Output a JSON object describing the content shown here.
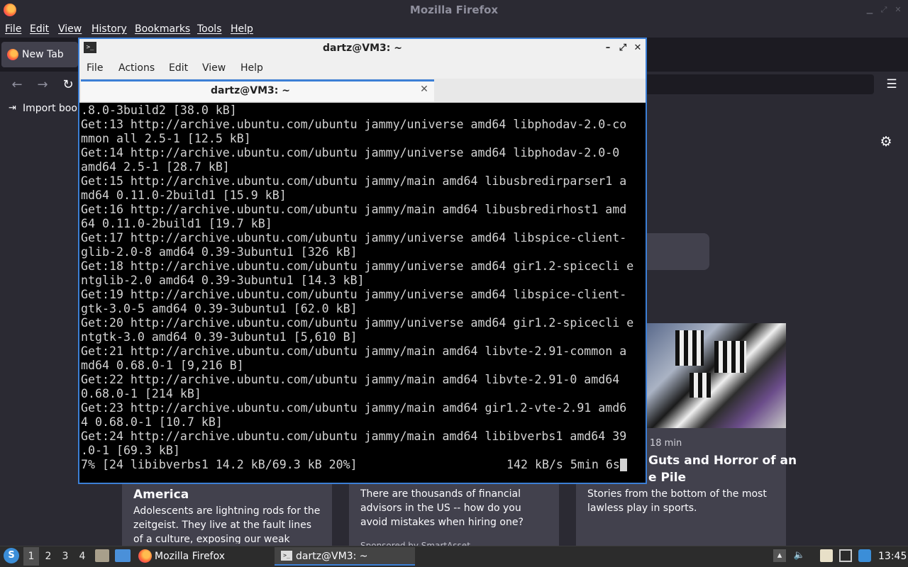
{
  "firefox": {
    "window_title": "Mozilla Firefox",
    "menu": [
      "File",
      "Edit",
      "View",
      "History",
      "Bookmarks",
      "Tools",
      "Help"
    ],
    "tab_label": "New Tab",
    "bookmarks_toolbar": {
      "import_label": "Import bookmarks..."
    },
    "cards": [
      {
        "title": "America",
        "body": "Adolescents are lightning rods for the zeitgeist. They live at the fault lines of a culture, exposing our weak spots,..."
      },
      {
        "body": "There are thousands of financial advisors in the US -- how do you avoid mistakes when hiring one?",
        "sponsor": "Sponsored by SmartAsset"
      },
      {
        "meta": "18 min",
        "title_line1": "Guts and Horror of an",
        "title_line2": "e Pile",
        "body": "Stories from the bottom of the most lawless play in sports."
      }
    ],
    "icons": [
      "firefox-logo-icon",
      "back-icon",
      "forward-icon",
      "reload-icon",
      "hamburger-menu-icon",
      "import-icon",
      "gear-icon"
    ]
  },
  "terminal": {
    "window_title": "dartz@VM3: ~",
    "menu": [
      "File",
      "Actions",
      "Edit",
      "View",
      "Help"
    ],
    "tab_label": "dartz@VM3: ~",
    "output_lines": [
      ".8.0-3build2 [38.0 kB]",
      "Get:13 http://archive.ubuntu.com/ubuntu jammy/universe amd64 libphodav-2.0-co",
      "mmon all 2.5-1 [12.5 kB]",
      "Get:14 http://archive.ubuntu.com/ubuntu jammy/universe amd64 libphodav-2.0-0",
      "amd64 2.5-1 [28.7 kB]",
      "Get:15 http://archive.ubuntu.com/ubuntu jammy/main amd64 libusbredirparser1 a",
      "md64 0.11.0-2build1 [15.9 kB]",
      "Get:16 http://archive.ubuntu.com/ubuntu jammy/main amd64 libusbredirhost1 amd",
      "64 0.11.0-2build1 [19.7 kB]",
      "Get:17 http://archive.ubuntu.com/ubuntu jammy/universe amd64 libspice-client-",
      "glib-2.0-8 amd64 0.39-3ubuntu1 [326 kB]",
      "Get:18 http://archive.ubuntu.com/ubuntu jammy/universe amd64 gir1.2-spicecli e",
      "ntglib-2.0 amd64 0.39-3ubuntu1 [14.3 kB]",
      "Get:19 http://archive.ubuntu.com/ubuntu jammy/universe amd64 libspice-client-",
      "gtk-3.0-5 amd64 0.39-3ubuntu1 [62.0 kB]",
      "Get:20 http://archive.ubuntu.com/ubuntu jammy/universe amd64 gir1.2-spicecli e",
      "ntgtk-3.0 amd64 0.39-3ubuntu1 [5,610 B]",
      "Get:21 http://archive.ubuntu.com/ubuntu jammy/main amd64 libvte-2.91-common a",
      "md64 0.68.0-1 [9,216 B]",
      "Get:22 http://archive.ubuntu.com/ubuntu jammy/main amd64 libvte-2.91-0 amd64",
      "0.68.0-1 [214 kB]",
      "Get:23 http://archive.ubuntu.com/ubuntu jammy/main amd64 gir1.2-vte-2.91 amd6",
      "4 0.68.0-1 [10.7 kB]",
      "Get:24 http://archive.ubuntu.com/ubuntu jammy/main amd64 libibverbs1 amd64 39",
      ".0-1 [69.3 kB]"
    ],
    "status_left": "7% [24 libibverbs1 14.2 kB/69.3 kB 20%]",
    "status_right": "142 kB/s 5min 6s"
  },
  "taskbar": {
    "start_icon_glyph": "S",
    "workspaces": [
      "1",
      "2",
      "3",
      "4"
    ],
    "apps": [
      {
        "label": "Mozilla Firefox",
        "icon": "firefox-icon"
      },
      {
        "label": "dartz@VM3: ~",
        "icon": "terminal-icon"
      }
    ],
    "clock": "13:45",
    "tray_icons": [
      "show-desktop-icon",
      "volume-icon",
      "clipboard-icon",
      "display-icon",
      "network-icon"
    ]
  },
  "colors": {
    "accent": "#3c7fd6",
    "terminal_bg": "#000000",
    "terminal_fg": "#d3d3d3",
    "firefox_bg": "#2b2a33"
  }
}
